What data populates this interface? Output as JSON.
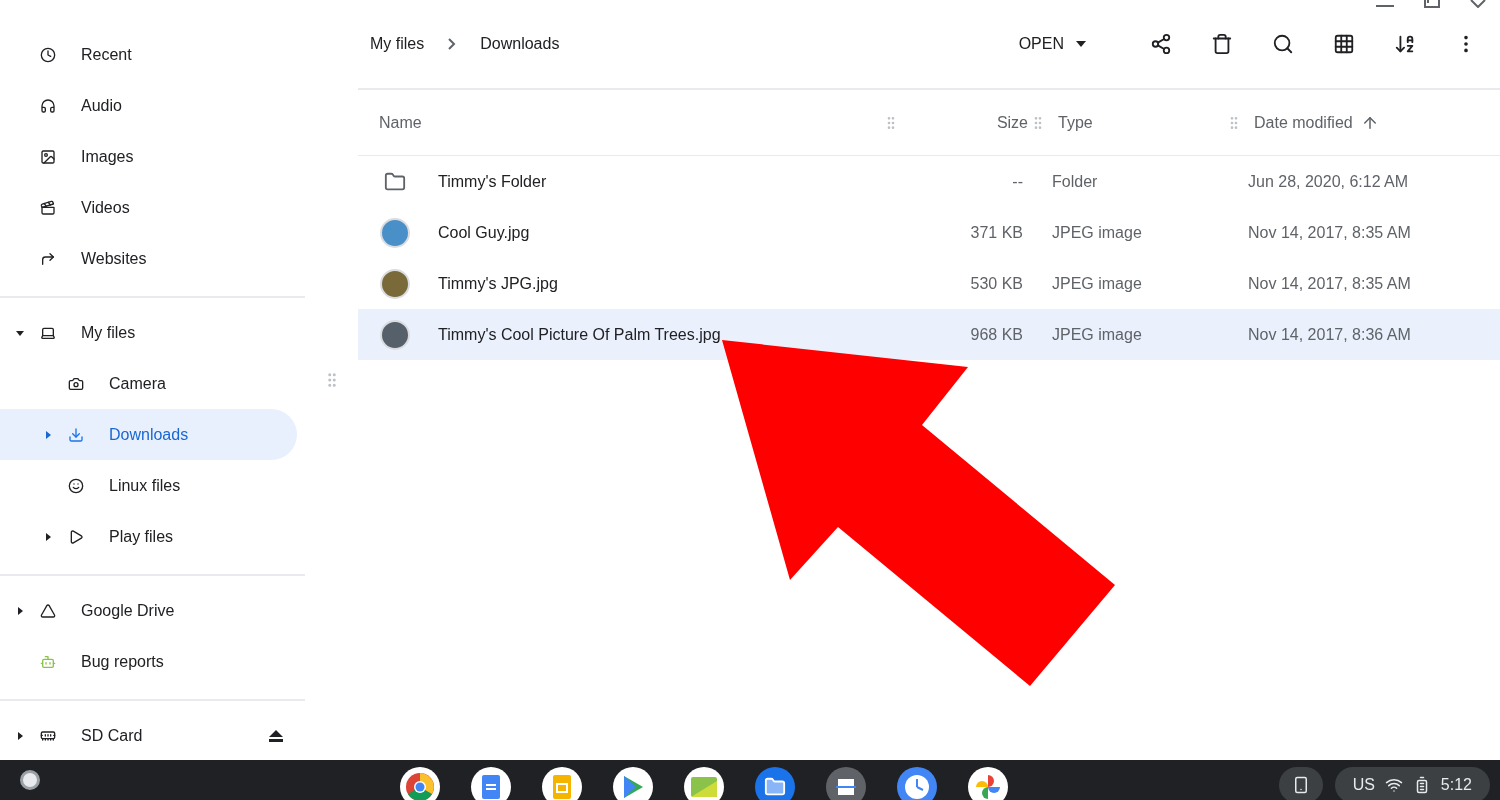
{
  "sidebar": {
    "sections": [
      {
        "items": [
          {
            "label": "Recent",
            "selected": false
          },
          {
            "label": "Audio",
            "selected": false
          },
          {
            "label": "Images",
            "selected": false
          },
          {
            "label": "Videos",
            "selected": false
          },
          {
            "label": "Websites",
            "selected": false
          }
        ]
      },
      {
        "items": [
          {
            "label": "My files",
            "selected": false,
            "expanded": true,
            "children": [
              {
                "label": "Camera",
                "selected": false
              },
              {
                "label": "Downloads",
                "selected": true,
                "expanded": false
              },
              {
                "label": "Linux files",
                "selected": false
              },
              {
                "label": "Play files",
                "selected": false,
                "expanded": false
              }
            ]
          }
        ]
      },
      {
        "items": [
          {
            "label": "Google Drive",
            "selected": false,
            "expanded": false
          },
          {
            "label": "Bug reports",
            "selected": false
          }
        ]
      },
      {
        "items": [
          {
            "label": "SD Card",
            "selected": false,
            "expanded": false,
            "ejectable": true
          }
        ]
      }
    ]
  },
  "breadcrumb": [
    "My files",
    "Downloads"
  ],
  "toolbar": {
    "open_button": "OPEN"
  },
  "table": {
    "columns": [
      {
        "label": "Name",
        "sorted": false
      },
      {
        "label": "Size",
        "sorted": false
      },
      {
        "label": "Type",
        "sorted": false
      },
      {
        "label": "Date modified",
        "sorted": true
      }
    ],
    "rows": [
      {
        "kind": "folder",
        "name": "Timmy's Folder",
        "size": "--",
        "type": "Folder",
        "date": "Jun 28, 2020, 6:12 AM",
        "selected": false
      },
      {
        "kind": "image",
        "name": "Cool Guy.jpg",
        "size": "371 KB",
        "type": "JPEG image",
        "date": "Nov 14, 2017, 8:35 AM",
        "selected": false
      },
      {
        "kind": "image",
        "name": "Timmy's JPG.jpg",
        "size": "530 KB",
        "type": "JPEG image",
        "date": "Nov 14, 2017, 8:35 AM",
        "selected": false
      },
      {
        "kind": "image",
        "name": "Timmy's Cool Picture Of Palm Trees.jpg",
        "size": "968 KB",
        "type": "JPEG image",
        "date": "Nov 14, 2017, 8:36 AM",
        "selected": true
      }
    ]
  },
  "tray": {
    "keyboard": "US",
    "time": "5:12"
  }
}
